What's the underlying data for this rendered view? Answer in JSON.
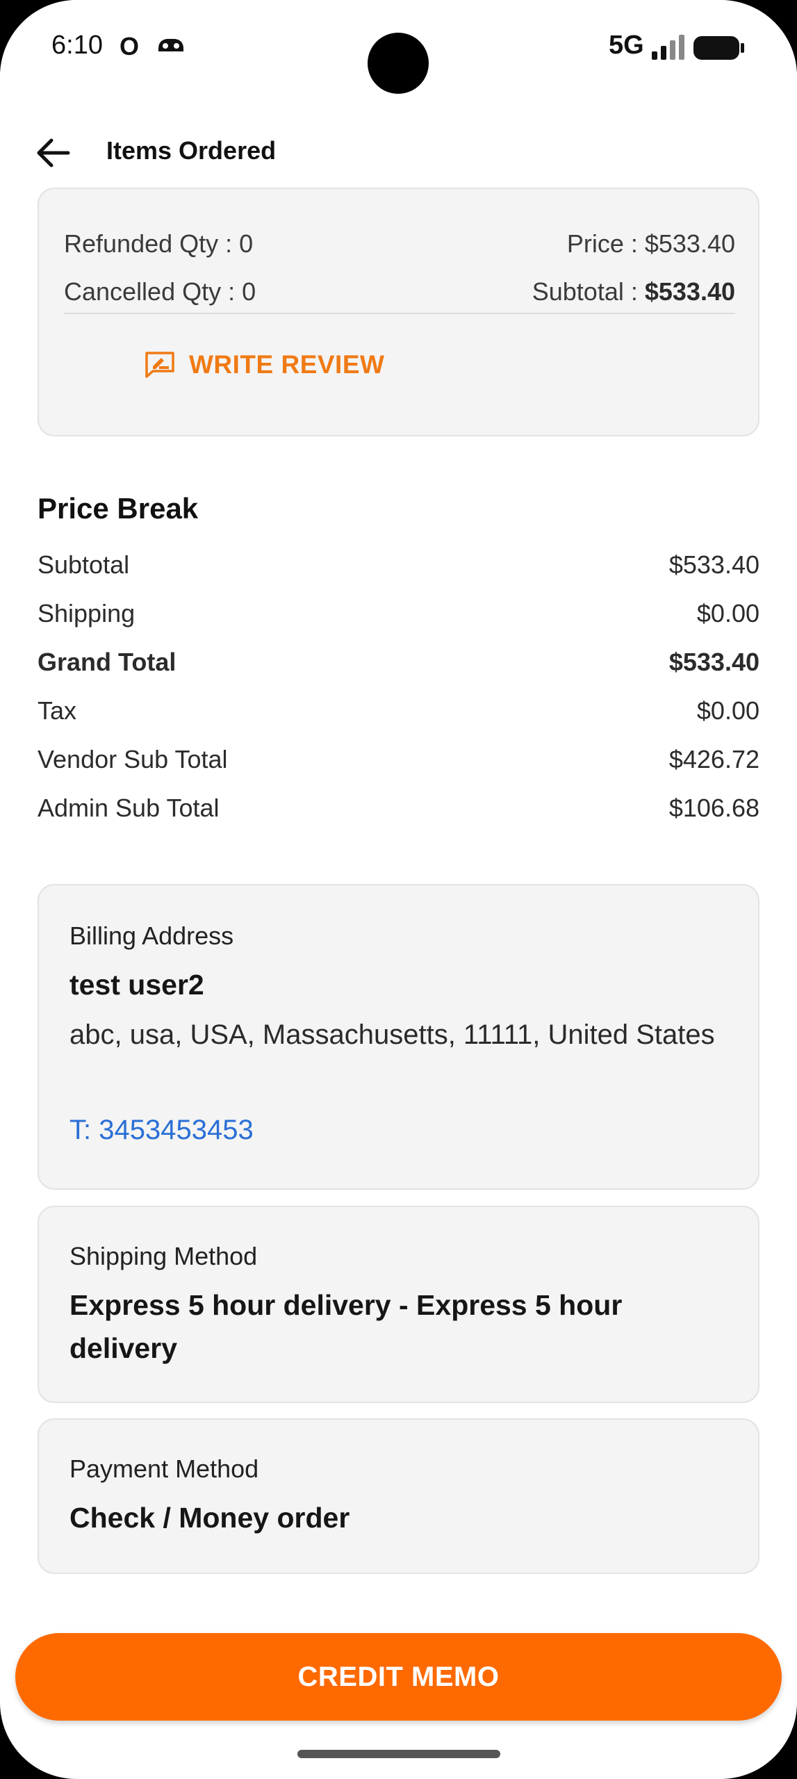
{
  "status_bar": {
    "time": "6:10",
    "network": "5G",
    "o_glyph": "O"
  },
  "header": {
    "title": "Items Ordered"
  },
  "item": {
    "refunded_qty": "Refunded Qty  : 0",
    "price": "Price : $533.40",
    "cancelled_qty": "Cancelled Qty : 0",
    "subtotal_label": "Subtotal : ",
    "subtotal_value": "$533.40",
    "write_review": "WRITE REVIEW"
  },
  "price_break": {
    "title": "Price Break",
    "rows": [
      {
        "label": "Subtotal",
        "value": "$533.40"
      },
      {
        "label": "Shipping",
        "value": "$0.00"
      },
      {
        "label": "Grand Total",
        "value": "$533.40"
      },
      {
        "label": "Tax",
        "value": "$0.00"
      },
      {
        "label": "Vendor Sub Total",
        "value": "$426.72"
      },
      {
        "label": "Admin Sub Total",
        "value": "$106.68"
      }
    ]
  },
  "billing": {
    "label": "Billing Address",
    "name": "test user2",
    "address": "abc, usa, USA,  Massachusetts, 11111, United States",
    "phone": "T: 3453453453"
  },
  "shipping": {
    "label": "Shipping Method",
    "method": "Express 5 hour delivery - Express 5 hour delivery"
  },
  "payment": {
    "label": "Payment Method",
    "method": "Check / Money order"
  },
  "actions": {
    "credit_memo": "CREDIT MEMO"
  },
  "colors": {
    "accent": "#ff6a00",
    "review": "#f07a14",
    "link": "#2a6fd6"
  }
}
